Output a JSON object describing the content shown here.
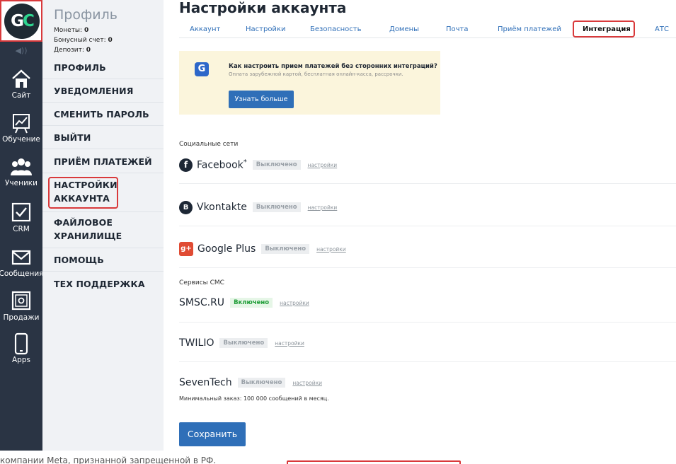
{
  "rail": {
    "logo": {
      "g": "G",
      "c": "C"
    },
    "items": [
      {
        "label": "Сайт",
        "icon": "house-icon"
      },
      {
        "label": "Обучение",
        "icon": "chart-board-icon"
      },
      {
        "label": "Ученики",
        "icon": "users-icon"
      },
      {
        "label": "CRM",
        "icon": "checkbox-icon"
      },
      {
        "label": "Сообщения",
        "icon": "envelope-icon"
      },
      {
        "label": "Продажи",
        "icon": "safe-icon"
      },
      {
        "label": "Apps",
        "icon": "phone-icon"
      }
    ]
  },
  "profile": {
    "title": "Профиль",
    "coins_label": "Монеты:",
    "coins_value": "0",
    "bonus_label": "Бонусный счет:",
    "bonus_value": "0",
    "deposit_label": "Депозит:",
    "deposit_value": "0",
    "menu": [
      "ПРОФИЛЬ",
      "УВЕДОМЛЕНИЯ",
      "СМЕНИТЬ ПАРОЛЬ",
      "ВЫЙТИ",
      "ПРИЁМ ПЛАТЕЖЕЙ",
      "НАСТРОЙКИ АККАУНТА",
      "ФАЙЛОВОЕ ХРАНИЛИЩЕ",
      "ПОМОЩЬ",
      "ТЕХ ПОДДЕРЖКА"
    ]
  },
  "page_title": "Настройки аккаунта",
  "tabs": [
    "Аккаунт",
    "Настройки",
    "Безопасность",
    "Домены",
    "Почта",
    "Приём платежей",
    "Интеграция",
    "АТС"
  ],
  "active_tab": "Интеграция",
  "promo": {
    "icon_letter": "G",
    "heading": "Как настроить прием платежей без сторонних интеграций?",
    "subtext": "Оплата зарубежной картой, бесплатная онлайн-касса, рассрочки.",
    "button": "Узнать больше"
  },
  "social": {
    "section_title": "Социальные сети",
    "items": [
      {
        "name": "Facebook",
        "mark": "*",
        "status": "Выключено",
        "link": "настройки",
        "icon": "facebook-icon"
      },
      {
        "name": "Vkontakte",
        "status": "Выключено",
        "link": "настройки",
        "icon": "vk-icon"
      },
      {
        "name": "Google Plus",
        "status": "Выключено",
        "link": "настройки",
        "icon": "google-plus-icon"
      }
    ]
  },
  "sms": {
    "section_title": "Сервисы СМС",
    "items": [
      {
        "name": "SMSC.RU",
        "status": "Включено",
        "link": "настройки"
      },
      {
        "name": "TWILIO",
        "status": "Выключено",
        "link": "настройки"
      },
      {
        "name": "SevenTech",
        "status": "Выключено",
        "link": "настройки"
      }
    ],
    "min_order_note": "Минимальный заказ: 100 000 сообщений в месяц."
  },
  "save_button": "Сохранить",
  "footnote": "компании Meta, признанной запрещенной в РФ.",
  "colors": {
    "accent": "#2f6fb8",
    "highlight": "#d9393b",
    "enabled": "#1c9c35",
    "rail": "#2a3444"
  }
}
